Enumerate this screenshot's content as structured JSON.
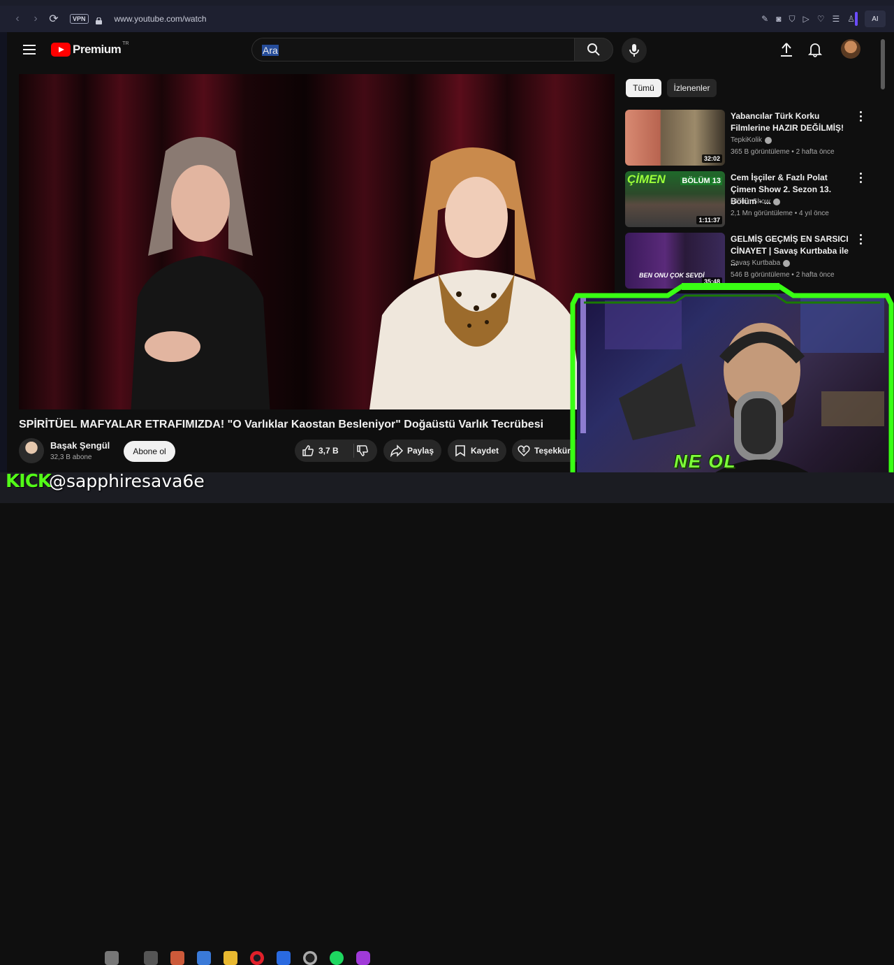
{
  "browser": {
    "vpn_label": "VPN",
    "url": "www.youtube.com/watch",
    "ai_label": "AI"
  },
  "header": {
    "brand": "Premium",
    "region": "TR",
    "search_value": "Ara"
  },
  "video": {
    "title": "SPİRİTÜEL MAFYALAR ETRAFIMIZDA! \"O Varlıklar Kaostan Besleniyor\" Doğaüstü Varlık Tecrübesi",
    "channel_name": "Başak Şengül",
    "subscribers": "32,3 B abone",
    "subscribe_label": "Abone ol",
    "like_count": "3,7 B",
    "share_label": "Paylaş",
    "save_label": "Kaydet",
    "thanks_label": "Teşekkür"
  },
  "sidebar": {
    "chips": [
      "Tümü",
      "İzlenenler"
    ],
    "recommendations": [
      {
        "title": "Yabancılar Türk Korku Filmlerine HAZIR DEĞİLMİŞ!",
        "channel": "TepkiKolik",
        "views": "365 B görüntüleme",
        "age": "2 hafta önce",
        "duration": "32:02"
      },
      {
        "title": "Cem İşçiler & Fazlı Polat Çimen Show 2. Sezon 13. Bölüm - ...",
        "channel": "Çimen Show",
        "views": "2,1 Mn görüntüleme",
        "age": "4 yıl önce",
        "duration": "1:11:37"
      },
      {
        "title": "GELMİŞ GEÇMİŞ EN SARSICI CİNAYET | Savaş Kurtbaba ile ...",
        "channel": "Savaş Kurtbaba",
        "views": "546 B görüntüleme",
        "age": "2 hafta önce",
        "duration": "35:48"
      }
    ],
    "thumb_text": [
      "ÇİMEN",
      "BÖLÜM 13",
      "BEN ONU ÇOK SEVDİ"
    ]
  },
  "overlay": {
    "cam_caption": "NE OL",
    "kick_label": "KICK",
    "handle": "@sapphiresava6e"
  },
  "colors": {
    "accent_red": "#ff0000",
    "kick_green": "#53fc18",
    "frame_green": "#39ff14"
  }
}
